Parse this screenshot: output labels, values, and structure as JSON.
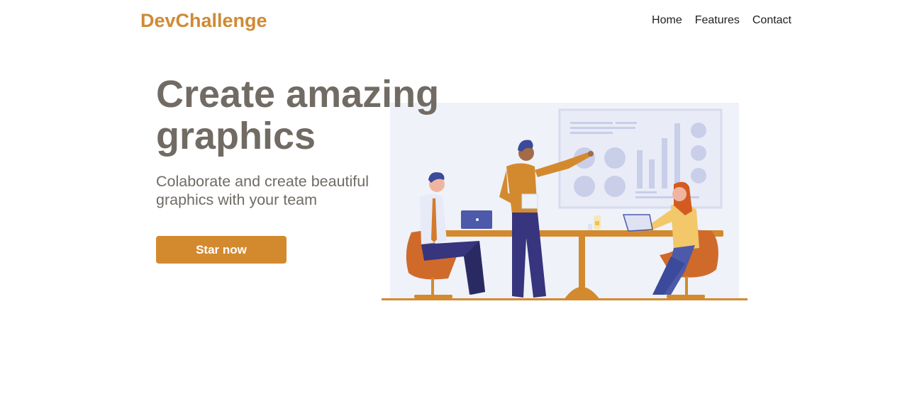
{
  "header": {
    "logo": "DevChallenge",
    "nav": [
      {
        "label": "Home"
      },
      {
        "label": "Features"
      },
      {
        "label": "Contact"
      }
    ]
  },
  "hero": {
    "title": "Create amazing graphics",
    "subtitle": "Colaborate and create beautiful graphics with your team",
    "cta_label": "Star now",
    "illustration": "team-meeting-illustration"
  },
  "colors": {
    "brand": "#d08a34",
    "button": "#d38a2e",
    "heading": "#716b64",
    "illustration_bg": "#eff2f9"
  }
}
